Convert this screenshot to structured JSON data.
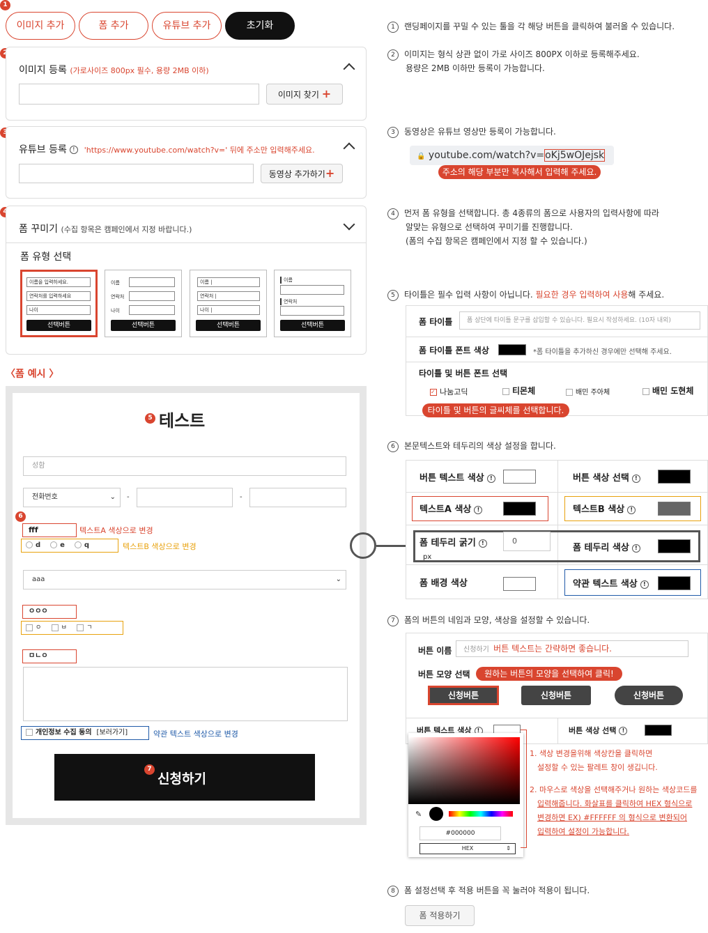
{
  "toolbar": {
    "add_image": "이미지 추가",
    "add_form": "폼 추가",
    "add_youtube": "유튜브 추가",
    "reset": "초기화"
  },
  "badges": [
    "1",
    "2",
    "3",
    "4",
    "5",
    "6",
    "7",
    "8"
  ],
  "image_panel": {
    "title": "이미지 등록",
    "note": "(가로사이즈 800px 필수, 용량 2MB 이하)",
    "find_button": "이미지 찾기"
  },
  "youtube_panel": {
    "title": "유튜브 등록",
    "note": "'https://www.youtube.com/watch?v=' 뒤에 주소만 입력해주세요.",
    "add_button": "동영상 추가하기"
  },
  "form_panel": {
    "title": "폼 꾸미기",
    "note": "(수집 항목은 캠페인에서 지정 바랍니다.)",
    "type_label": "폼 유형 선택",
    "select_button": "선택버튼",
    "card1": [
      "이름을 입력하세요.",
      "연락처를 입력하세요",
      "나이"
    ],
    "card_labels": [
      "이름",
      "연락처",
      "나이"
    ],
    "card3": [
      "이름 |",
      "연락처 |",
      "나이 |"
    ],
    "card4": [
      "이름",
      "연락처"
    ]
  },
  "example": {
    "heading": "〈폼 예시 〉",
    "title": "테스트",
    "name_placeholder": "성함",
    "phone_select": "전화번호",
    "dash": "-",
    "text_a": "fff",
    "text_a_note": "텍스트A 색상으로 변경",
    "radio_opts": [
      "d",
      "e",
      "q"
    ],
    "text_b_note": "텍스트B 색상으로 변경",
    "select_val": "aaa",
    "text_c": "ㅇㅇㅇ",
    "check_opts": [
      "ㅇ",
      "ㅂ",
      "ㄱ"
    ],
    "text_d": "ㅁㄴㅇ",
    "privacy": "개인정보 수집 동의",
    "privacy_link": "[보러가기]",
    "privacy_note": "약관 텍스트 색상으로 변경",
    "submit": "신청하기"
  },
  "steps": {
    "s1": "랜딩페이지를 꾸밀 수 있는 툴을 각 해당 버튼을 클릭하여 불러올 수 있습니다.",
    "s2a": "이미지는 형식 상관 없이 가로 사이즈 800PX 이하로 등록해주세요.",
    "s2b": "용량은 2MB 이하만 등록이 가능합니다.",
    "s3": "동영상은 유튜브 영상만 등록이 가능합니다.",
    "s3_url": "youtube.com/watch?v=",
    "s3_id": "oKj5wOJejsk",
    "s3_tip": "주소의 해당 부분만 복사해서 입력해 주세요.",
    "s4a": "먼저 폼 유형을 선택합니다. 총 4종류의 폼으로 사용자의 입력사항에 따라",
    "s4b": "알맞는 유형으로 선택하여 꾸미기를 진행합니다.",
    "s4c": "(폼의 수집 항목은 캠페인에서 지정 할 수 있습니다.)",
    "s5a": "타이틀은 필수 입력 사항이 아닙니다.",
    "s5b": "필요한 경우 입력하여 사용",
    "s5c": "해 주세요.",
    "s6": "본문텍스트와 테두리의 색상 설정을 합니다.",
    "s7": "폼의 버튼의 네임과 모양, 색상을 설정할 수 있습니다.",
    "s8": "폼 설정선택 후 적용 버튼을 꼭 눌러야 적용이 됩니다."
  },
  "title_settings": {
    "label": "폼 타이틀",
    "placeholder": "폼 상단에 타이틀 문구를 삽입할 수 있습니다. 필요시 작성하세요. (10자 내외)",
    "font_color": "폼 타이틀 폰트 색상",
    "font_note": "*폼 타이틀을 추가하신 경우에만 선택해 주세요.",
    "font_select": "타이틀 및 버튼 폰트 선택",
    "fonts": [
      "나눔고딕",
      "티몬체",
      "배민 주아체",
      "배민 도현체"
    ],
    "tip": "타이틀 및 버튼의 글씨체를 선택합니다."
  },
  "color_settings": {
    "btn_text": "버튼 텍스트 색상",
    "btn_color": "버튼 색상 선택",
    "text_a": "텍스트A 색상",
    "text_b": "텍스트B 색상",
    "border_width": "폼 테두리 굵기",
    "border_val": "0",
    "px": "px",
    "border_color": "폼 테두리 색상",
    "bg": "폼 배경 색상",
    "terms": "약관 텍스트 색상"
  },
  "button_settings": {
    "name_label": "버튼 이름",
    "name_val": "신청하기",
    "name_note": "버튼 텍스트는 간략하면 좋습니다.",
    "shape_label": "버튼 모양 선택",
    "shape_tip": "원하는 버튼의 모양을 선택하여 클릭!",
    "shape": "신청버튼",
    "btn_text": "버튼 텍스트 색상",
    "btn_color": "버튼 색상 선택",
    "hex_val": "#000000",
    "hex_mode": "HEX",
    "note1a": "1. 색상 변경을위해 색상칸을 클릭하면",
    "note1b": "설정할 수 있는 팔레트 창이 생깁니다.",
    "note2a": "2. 마우스로 색상을 선택해주거나 원하는 색상코드를",
    "note2b": "입력해줍니다. 화살표를 클릭하여 HEX 형식으로",
    "note2c": "변경하면 EX) #FFFFFF 의 형식으로 변환되어",
    "note2d": "입력하여 설정이 가능합니다."
  },
  "apply_button": "폼 적용하기"
}
